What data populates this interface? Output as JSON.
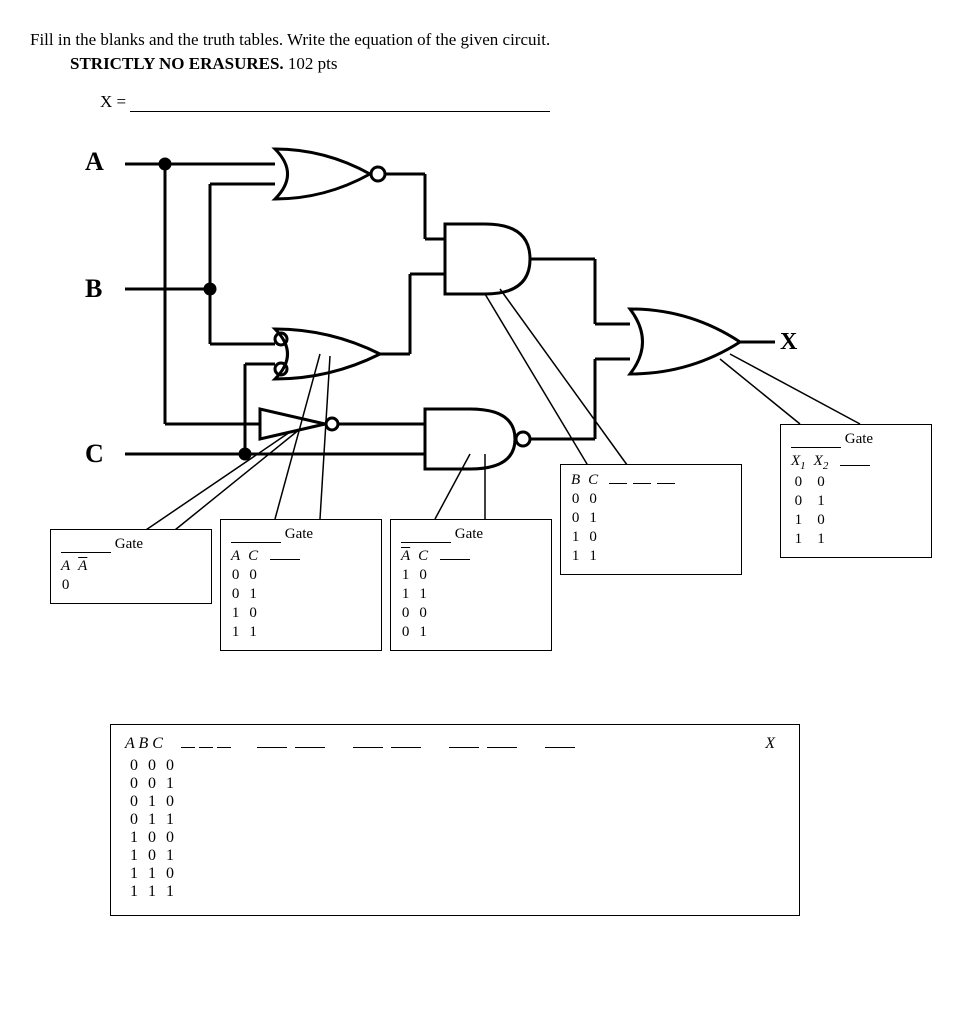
{
  "instructions": "Fill in the blanks and the truth tables. Write the equation of the given circuit.",
  "strict": "STRICTLY NO ERASURES.",
  "pts": "102 pts",
  "equation_label": "X =",
  "gate_word": "Gate",
  "inputs": {
    "A": "A",
    "B": "B",
    "C": "C"
  },
  "output": "X",
  "box1": {
    "headers": [
      "A",
      "A̅"
    ],
    "rows": [
      [
        "0",
        ""
      ]
    ]
  },
  "box2": {
    "headers": [
      "A",
      "C",
      ""
    ],
    "rows": [
      [
        "0",
        "0",
        ""
      ],
      [
        "0",
        "1",
        ""
      ],
      [
        "1",
        "0",
        ""
      ],
      [
        "1",
        "1",
        ""
      ]
    ]
  },
  "box3": {
    "headers": [
      "A̅",
      "C",
      ""
    ],
    "rows": [
      [
        "1",
        "0",
        ""
      ],
      [
        "1",
        "1",
        ""
      ],
      [
        "0",
        "0",
        ""
      ],
      [
        "0",
        "1",
        ""
      ]
    ]
  },
  "box4": {
    "headers": [
      "B",
      "C",
      ""
    ],
    "rows": [
      [
        "0",
        "0",
        ""
      ],
      [
        "0",
        "1",
        ""
      ],
      [
        "1",
        "0",
        ""
      ],
      [
        "1",
        "1",
        ""
      ]
    ]
  },
  "box5": {
    "headers": [
      "X₁",
      "X₂",
      ""
    ],
    "rows": [
      [
        "0",
        "0",
        ""
      ],
      [
        "0",
        "1",
        ""
      ],
      [
        "1",
        "0",
        ""
      ],
      [
        "1",
        "1",
        ""
      ]
    ]
  },
  "bigtable": {
    "headers": [
      "A",
      "B",
      "C"
    ],
    "output_header": "X",
    "rows": [
      [
        "0",
        "0",
        "0"
      ],
      [
        "0",
        "0",
        "1"
      ],
      [
        "0",
        "1",
        "0"
      ],
      [
        "0",
        "1",
        "1"
      ],
      [
        "1",
        "0",
        "0"
      ],
      [
        "1",
        "0",
        "1"
      ],
      [
        "1",
        "1",
        "0"
      ],
      [
        "1",
        "1",
        "1"
      ]
    ]
  }
}
